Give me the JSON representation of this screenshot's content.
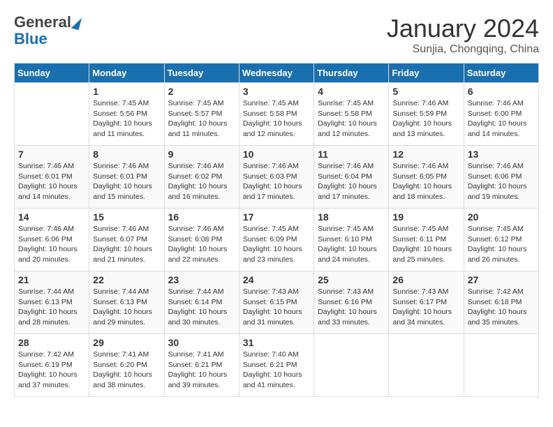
{
  "header": {
    "logo_line1": "General",
    "logo_line2": "Blue",
    "month_year": "January 2024",
    "location": "Sunjia, Chongqing, China"
  },
  "days_of_week": [
    "Sunday",
    "Monday",
    "Tuesday",
    "Wednesday",
    "Thursday",
    "Friday",
    "Saturday"
  ],
  "weeks": [
    [
      {
        "num": "",
        "info": ""
      },
      {
        "num": "1",
        "info": "Sunrise: 7:45 AM\nSunset: 5:56 PM\nDaylight: 10 hours\nand 11 minutes."
      },
      {
        "num": "2",
        "info": "Sunrise: 7:45 AM\nSunset: 5:57 PM\nDaylight: 10 hours\nand 11 minutes."
      },
      {
        "num": "3",
        "info": "Sunrise: 7:45 AM\nSunset: 5:58 PM\nDaylight: 10 hours\nand 12 minutes."
      },
      {
        "num": "4",
        "info": "Sunrise: 7:45 AM\nSunset: 5:58 PM\nDaylight: 10 hours\nand 12 minutes."
      },
      {
        "num": "5",
        "info": "Sunrise: 7:46 AM\nSunset: 5:59 PM\nDaylight: 10 hours\nand 13 minutes."
      },
      {
        "num": "6",
        "info": "Sunrise: 7:46 AM\nSunset: 6:00 PM\nDaylight: 10 hours\nand 14 minutes."
      }
    ],
    [
      {
        "num": "7",
        "info": "Sunrise: 7:46 AM\nSunset: 6:01 PM\nDaylight: 10 hours\nand 14 minutes."
      },
      {
        "num": "8",
        "info": "Sunrise: 7:46 AM\nSunset: 6:01 PM\nDaylight: 10 hours\nand 15 minutes."
      },
      {
        "num": "9",
        "info": "Sunrise: 7:46 AM\nSunset: 6:02 PM\nDaylight: 10 hours\nand 16 minutes."
      },
      {
        "num": "10",
        "info": "Sunrise: 7:46 AM\nSunset: 6:03 PM\nDaylight: 10 hours\nand 17 minutes."
      },
      {
        "num": "11",
        "info": "Sunrise: 7:46 AM\nSunset: 6:04 PM\nDaylight: 10 hours\nand 17 minutes."
      },
      {
        "num": "12",
        "info": "Sunrise: 7:46 AM\nSunset: 6:05 PM\nDaylight: 10 hours\nand 18 minutes."
      },
      {
        "num": "13",
        "info": "Sunrise: 7:46 AM\nSunset: 6:06 PM\nDaylight: 10 hours\nand 19 minutes."
      }
    ],
    [
      {
        "num": "14",
        "info": "Sunrise: 7:46 AM\nSunset: 6:06 PM\nDaylight: 10 hours\nand 20 minutes."
      },
      {
        "num": "15",
        "info": "Sunrise: 7:46 AM\nSunset: 6:07 PM\nDaylight: 10 hours\nand 21 minutes."
      },
      {
        "num": "16",
        "info": "Sunrise: 7:46 AM\nSunset: 6:08 PM\nDaylight: 10 hours\nand 22 minutes."
      },
      {
        "num": "17",
        "info": "Sunrise: 7:45 AM\nSunset: 6:09 PM\nDaylight: 10 hours\nand 23 minutes."
      },
      {
        "num": "18",
        "info": "Sunrise: 7:45 AM\nSunset: 6:10 PM\nDaylight: 10 hours\nand 24 minutes."
      },
      {
        "num": "19",
        "info": "Sunrise: 7:45 AM\nSunset: 6:11 PM\nDaylight: 10 hours\nand 25 minutes."
      },
      {
        "num": "20",
        "info": "Sunrise: 7:45 AM\nSunset: 6:12 PM\nDaylight: 10 hours\nand 26 minutes."
      }
    ],
    [
      {
        "num": "21",
        "info": "Sunrise: 7:44 AM\nSunset: 6:13 PM\nDaylight: 10 hours\nand 28 minutes."
      },
      {
        "num": "22",
        "info": "Sunrise: 7:44 AM\nSunset: 6:13 PM\nDaylight: 10 hours\nand 29 minutes."
      },
      {
        "num": "23",
        "info": "Sunrise: 7:44 AM\nSunset: 6:14 PM\nDaylight: 10 hours\nand 30 minutes."
      },
      {
        "num": "24",
        "info": "Sunrise: 7:43 AM\nSunset: 6:15 PM\nDaylight: 10 hours\nand 31 minutes."
      },
      {
        "num": "25",
        "info": "Sunrise: 7:43 AM\nSunset: 6:16 PM\nDaylight: 10 hours\nand 33 minutes."
      },
      {
        "num": "26",
        "info": "Sunrise: 7:43 AM\nSunset: 6:17 PM\nDaylight: 10 hours\nand 34 minutes."
      },
      {
        "num": "27",
        "info": "Sunrise: 7:42 AM\nSunset: 6:18 PM\nDaylight: 10 hours\nand 35 minutes."
      }
    ],
    [
      {
        "num": "28",
        "info": "Sunrise: 7:42 AM\nSunset: 6:19 PM\nDaylight: 10 hours\nand 37 minutes."
      },
      {
        "num": "29",
        "info": "Sunrise: 7:41 AM\nSunset: 6:20 PM\nDaylight: 10 hours\nand 38 minutes."
      },
      {
        "num": "30",
        "info": "Sunrise: 7:41 AM\nSunset: 6:21 PM\nDaylight: 10 hours\nand 39 minutes."
      },
      {
        "num": "31",
        "info": "Sunrise: 7:40 AM\nSunset: 6:21 PM\nDaylight: 10 hours\nand 41 minutes."
      },
      {
        "num": "",
        "info": ""
      },
      {
        "num": "",
        "info": ""
      },
      {
        "num": "",
        "info": ""
      }
    ]
  ]
}
